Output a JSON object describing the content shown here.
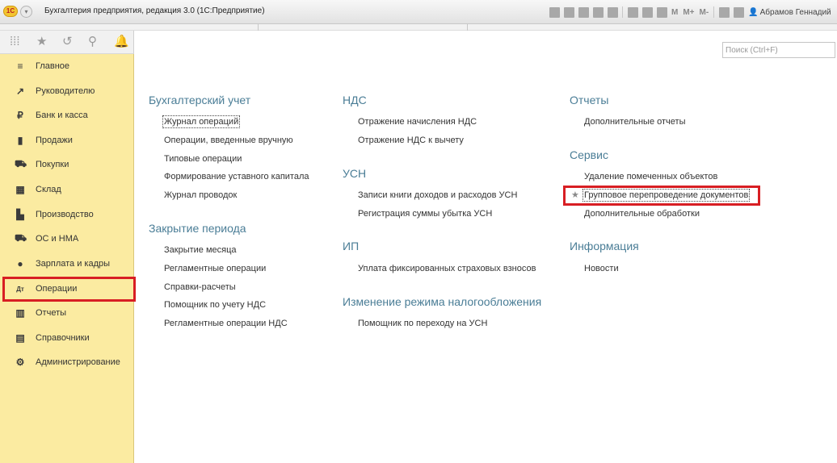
{
  "window": {
    "title": "Бухгалтерия предприятия, редакция 3.0 (1С:Предприятие)",
    "logo_text": "1С",
    "toolbar_labels": [
      "M",
      "M+",
      "M-"
    ],
    "user_name": "Абрамов Геннадий"
  },
  "sidebar": {
    "top_icons": [
      "apps-grid-icon",
      "star-icon",
      "history-icon",
      "search-icon",
      "bell-icon"
    ],
    "items": [
      {
        "label": "Главное",
        "icon": "menu-lines-icon",
        "glyph": "≡"
      },
      {
        "label": "Руководителю",
        "icon": "trend-icon",
        "glyph": "↗"
      },
      {
        "label": "Банк и касса",
        "icon": "ruble-coin-icon",
        "glyph": "₽"
      },
      {
        "label": "Продажи",
        "icon": "shopping-bag-icon",
        "glyph": "▮"
      },
      {
        "label": "Покупки",
        "icon": "cart-icon",
        "glyph": "⛟"
      },
      {
        "label": "Склад",
        "icon": "warehouse-icon",
        "glyph": "▦"
      },
      {
        "label": "Производство",
        "icon": "factory-icon",
        "glyph": "▙"
      },
      {
        "label": "ОС и НМА",
        "icon": "truck-icon",
        "glyph": "⛟"
      },
      {
        "label": "Зарплата и кадры",
        "icon": "person-icon",
        "glyph": "●"
      },
      {
        "label": "Операции",
        "icon": "dt-kt-icon",
        "glyph": "Дт"
      },
      {
        "label": "Отчеты",
        "icon": "bar-chart-icon",
        "glyph": "▥"
      },
      {
        "label": "Справочники",
        "icon": "book-icon",
        "glyph": "▤"
      },
      {
        "label": "Администрирование",
        "icon": "gear-icon",
        "glyph": "⚙"
      }
    ],
    "selected": "Операции",
    "highlight_color": "#d81e23"
  },
  "search": {
    "placeholder": "Поиск (Ctrl+F)",
    "value": ""
  },
  "content": {
    "col1": {
      "group1": {
        "title": "Бухгалтерский учет",
        "items": [
          "Журнал операций",
          "Операции, введенные вручную",
          "Типовые операции",
          "Формирование уставного капитала",
          "Журнал проводок"
        ]
      },
      "group2": {
        "title": "Закрытие периода",
        "items": [
          "Закрытие месяца",
          "Регламентные операции",
          "Справки-расчеты",
          "Помощник по учету НДС",
          "Регламентные операции НДС"
        ]
      }
    },
    "col2": {
      "group1": {
        "title": "НДС",
        "items": [
          "Отражение начисления НДС",
          "Отражение НДС к вычету"
        ]
      },
      "group2": {
        "title": "УСН",
        "items": [
          "Записи книги доходов и расходов УСН",
          "Регистрация суммы убытка УСН"
        ]
      },
      "group3": {
        "title": "ИП",
        "items": [
          "Уплата фиксированных страховых взносов"
        ]
      },
      "group4": {
        "title": "Изменение режима налогообложения",
        "items": [
          "Помощник по переходу на УСН"
        ]
      }
    },
    "col3": {
      "group1": {
        "title": "Отчеты",
        "items": [
          "Дополнительные отчеты"
        ]
      },
      "group2": {
        "title": "Сервис",
        "items": [
          "Удаление помеченных объектов",
          "Групповое перепроведение документов",
          "Дополнительные обработки"
        ]
      },
      "group3": {
        "title": "Информация",
        "items": [
          "Новости"
        ]
      }
    },
    "highlighted_item": "Групповое перепроведение документов",
    "group_title_color": "#4a7d96"
  }
}
